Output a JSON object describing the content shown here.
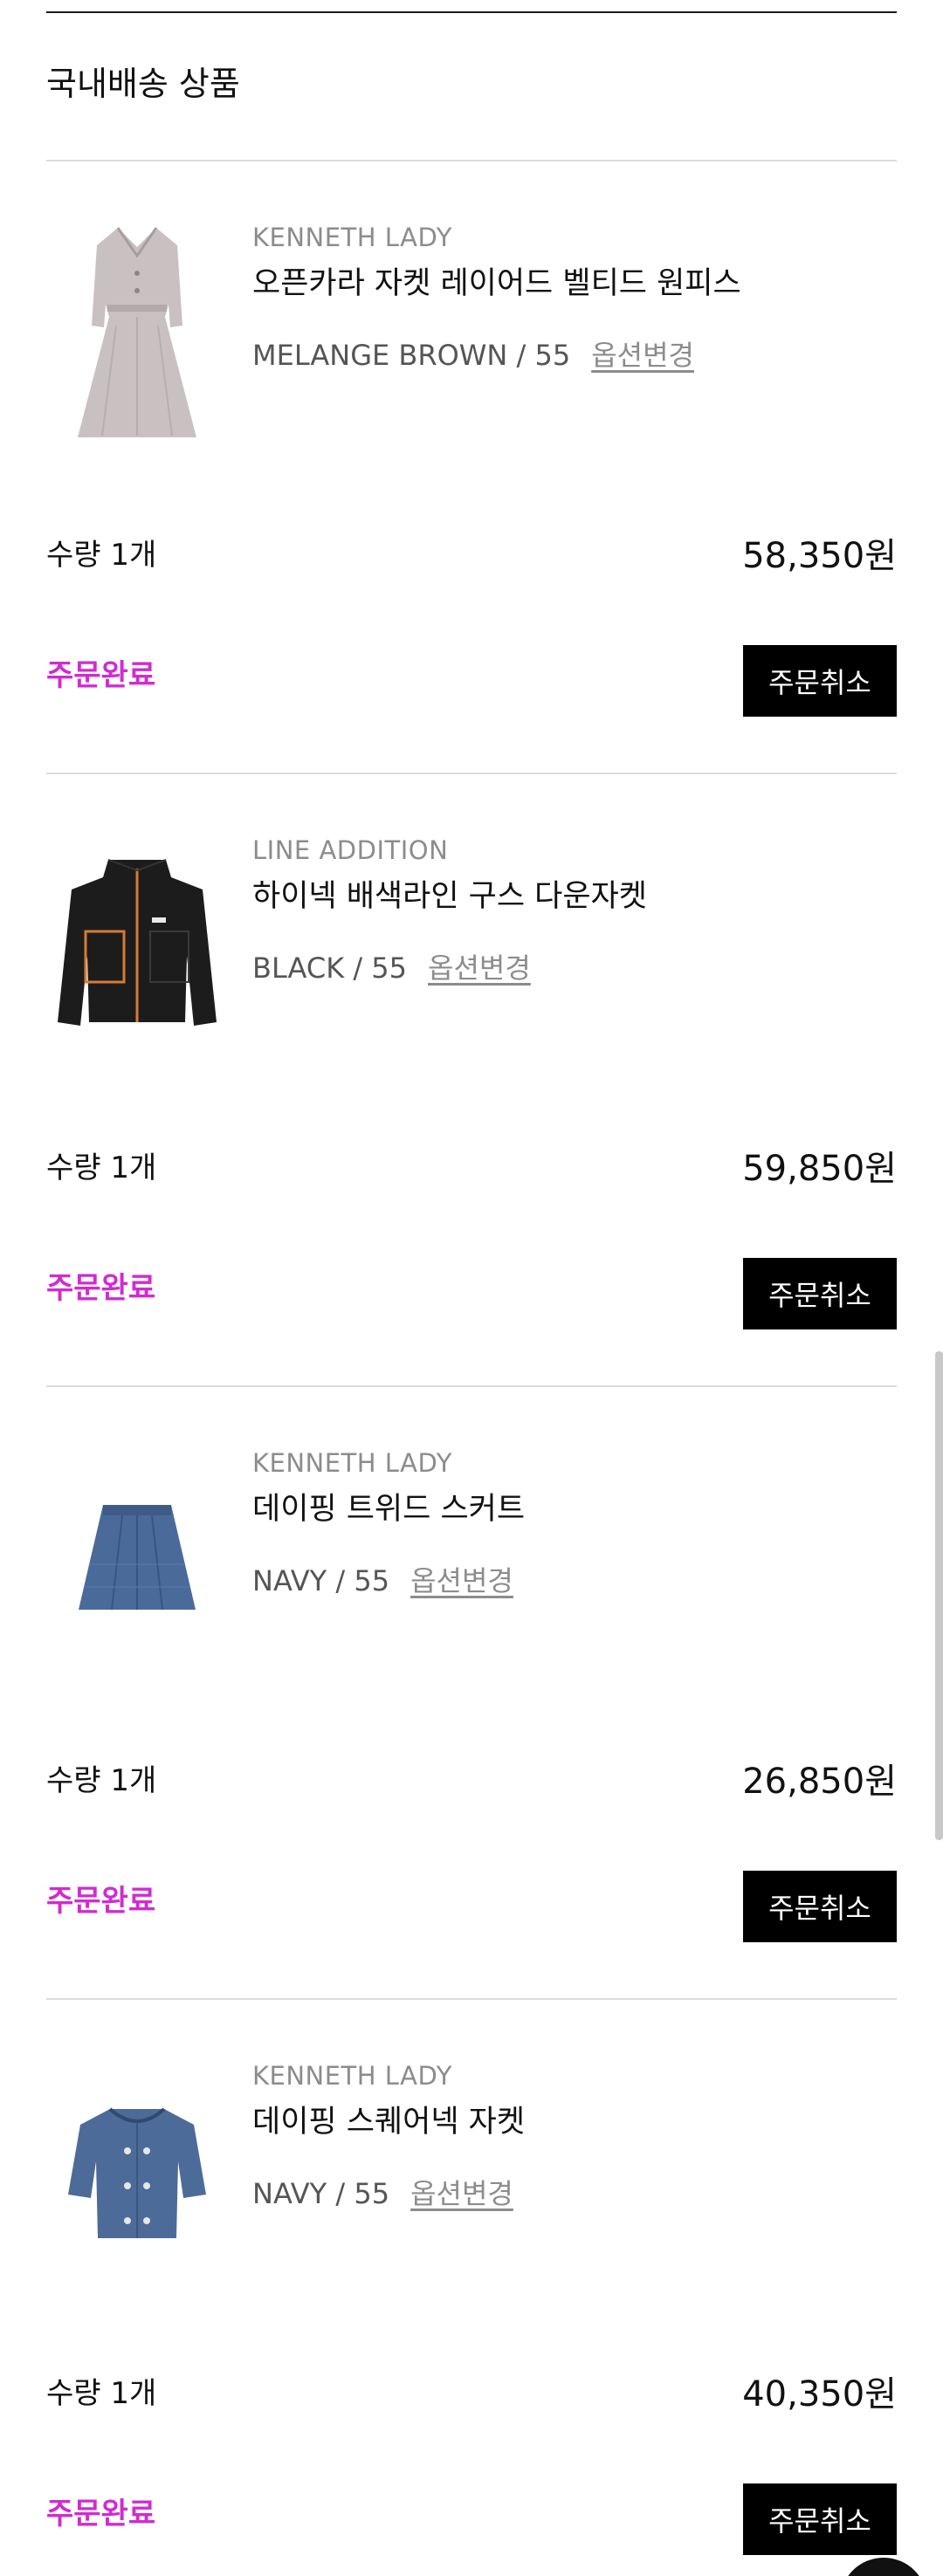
{
  "section": {
    "title": "국내배송 상품"
  },
  "items": [
    {
      "brand": "KENNETH LADY",
      "name": "오픈카라 자켓 레이어드 벨티드 원피스",
      "option": "MELANGE BROWN / 55",
      "option_change": "옵션변경",
      "quantity": "수량 1개",
      "price": "58,350원",
      "status": "주문완료",
      "cancel": "주문취소",
      "thumb_icon": "dress-icon"
    },
    {
      "brand": "LINE ADDITION",
      "name": "하이넥 배색라인 구스 다운자켓",
      "option": "BLACK / 55",
      "option_change": "옵션변경",
      "quantity": "수량 1개",
      "price": "59,850원",
      "status": "주문완료",
      "cancel": "주문취소",
      "thumb_icon": "down-jacket-icon"
    },
    {
      "brand": "KENNETH LADY",
      "name": "데이핑 트위드 스커트",
      "option": "NAVY / 55",
      "option_change": "옵션변경",
      "quantity": "수량 1개",
      "price": "26,850원",
      "status": "주문완료",
      "cancel": "주문취소",
      "thumb_icon": "skirt-icon"
    },
    {
      "brand": "KENNETH LADY",
      "name": "데이핑 스퀘어넥 자켓",
      "option": "NAVY / 55",
      "option_change": "옵션변경",
      "quantity": "수량 1개",
      "price": "40,350원",
      "status": "주문완료",
      "cancel": "주문취소",
      "thumb_icon": "tweed-jacket-icon"
    }
  ],
  "colors": {
    "status": "#d12bd1",
    "button_bg": "#000000",
    "divider": "#dcdcdc"
  }
}
